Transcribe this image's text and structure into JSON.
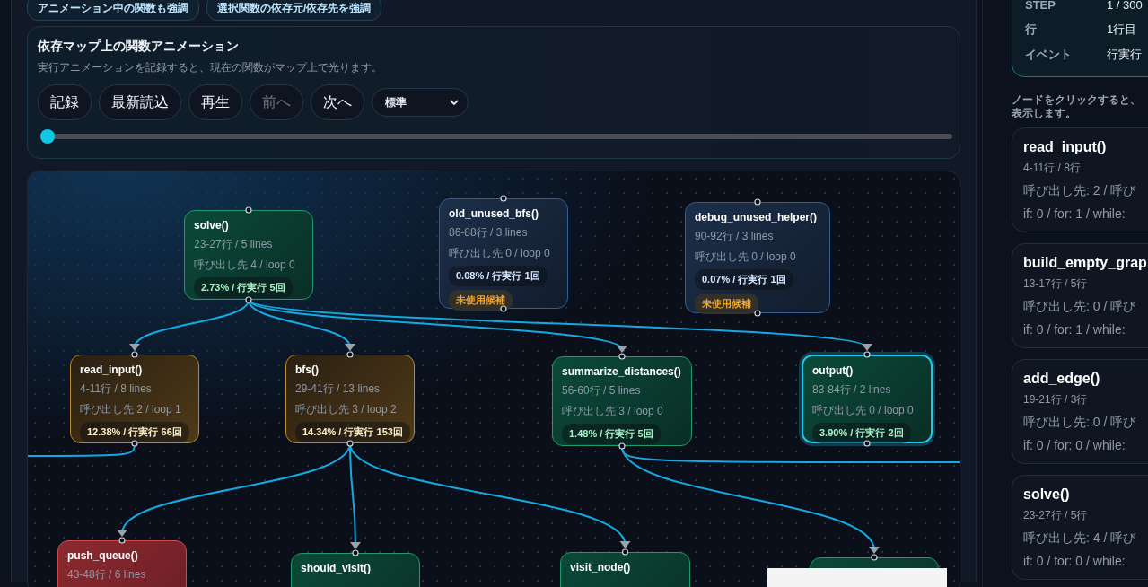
{
  "highlight_chips": [
    {
      "label": "アニメーション中の関数も強調"
    },
    {
      "label": "選択関数の依存元/依存先を強調"
    }
  ],
  "animation": {
    "title": "依存マップ上の関数アニメーション",
    "description": "実行アニメーションを記録すると、現在の関数がマップ上で光ります。",
    "buttons": [
      {
        "label": "記録",
        "disabled": false
      },
      {
        "label": "最新読込",
        "disabled": false
      },
      {
        "label": "再生",
        "disabled": false
      },
      {
        "label": "前へ",
        "disabled": true
      },
      {
        "label": "次へ",
        "disabled": false
      }
    ],
    "speed": "標準",
    "level": 0
  },
  "graph": {
    "nodes": [
      {
        "kind": "green",
        "name": "solve()",
        "range": "23-27行 / 5 lines",
        "calls": "呼び出し先 4 / loop 0",
        "stat": "2.73% / 行実行 5回",
        "highlighted": false
      },
      {
        "kind": "blue",
        "name": "old_unused_bfs()",
        "range": "86-88行 / 3 lines",
        "calls": "呼び出し先 0 / loop 0",
        "stat": "0.08% / 行実行 1回",
        "badge": "未使用候補",
        "highlighted": false
      },
      {
        "kind": "blue",
        "name": "debug_unused_helper()",
        "range": "90-92行 / 3 lines",
        "calls": "呼び出し先 0 / loop 0",
        "stat": "0.07% / 行実行 1回",
        "badge": "未使用候補",
        "highlighted": false
      },
      {
        "kind": "amber",
        "name": "read_input()",
        "range": "4-11行 / 8 lines",
        "calls": "呼び出し先 2 / loop 1",
        "stat": "12.38% / 行実行 66回",
        "highlighted": false
      },
      {
        "kind": "amber",
        "name": "bfs()",
        "range": "29-41行 / 13 lines",
        "calls": "呼び出し先 3 / loop 2",
        "stat": "14.34% / 行実行 153回",
        "highlighted": false
      },
      {
        "kind": "green",
        "name": "summarize_distances()",
        "range": "56-60行 / 5 lines",
        "calls": "呼び出し先 3 / loop 0",
        "stat": "1.48% / 行実行 5回",
        "highlighted": false
      },
      {
        "kind": "green",
        "name": "output()",
        "range": "83-84行 / 2 lines",
        "calls": "呼び出し先 0 / loop 0",
        "stat": "3.90% / 行実行 2回",
        "highlighted": true
      },
      {
        "kind": "red",
        "name": "push_queue()",
        "range": "43-48行 / 6 lines",
        "highlighted": false
      },
      {
        "kind": "green",
        "name": "should_visit()",
        "highlighted": false
      },
      {
        "kind": "green",
        "name": "visit_node()",
        "highlighted": false
      },
      {
        "kind": "green",
        "highlighted": false
      }
    ]
  },
  "execution": {
    "rows": [
      {
        "label": "STEP",
        "value": "1 / 300"
      },
      {
        "label": "行",
        "value": "1行目"
      },
      {
        "label": "イベント",
        "value": "行実行"
      }
    ]
  },
  "hint": [
    "ノードをクリックすると、",
    "表示します。"
  ],
  "functions": [
    {
      "name": "read_input()",
      "range": "4-11行 / 8行",
      "calls": "呼び出し先: 2 / 呼び",
      "loops": "if: 0 / for: 1 / while:"
    },
    {
      "name": "build_empty_grap",
      "range": "13-17行 / 5行",
      "calls": "呼び出し先: 0 / 呼び",
      "loops": "if: 0 / for: 1 / while:"
    },
    {
      "name": "add_edge()",
      "range": "19-21行 / 3行",
      "calls": "呼び出し先: 0 / 呼び",
      "loops": "if: 0 / for: 0 / while:"
    },
    {
      "name": "solve()",
      "range": "23-27行 / 5行",
      "calls": "呼び出し先: 4 / 呼び",
      "loops": "if: 0 / for: 0 / while:"
    }
  ]
}
